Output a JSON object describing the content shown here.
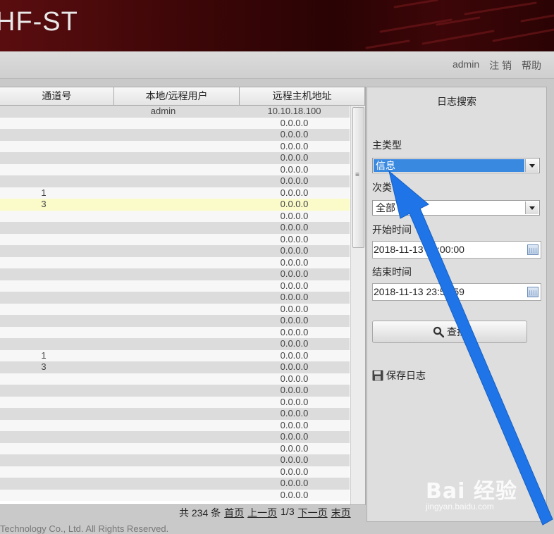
{
  "header": {
    "title": "HF-ST"
  },
  "toolbar": {
    "user": "admin",
    "logout": "注 销",
    "help": "帮助"
  },
  "table": {
    "columns": [
      "通道号",
      "本地/远程用户",
      "远程主机地址"
    ],
    "rows": [
      {
        "channel": "",
        "user": "admin",
        "host": "10.10.18.100"
      },
      {
        "channel": "",
        "user": "",
        "host": "0.0.0.0"
      },
      {
        "channel": "",
        "user": "",
        "host": "0.0.0.0"
      },
      {
        "channel": "",
        "user": "",
        "host": "0.0.0.0"
      },
      {
        "channel": "",
        "user": "",
        "host": "0.0.0.0"
      },
      {
        "channel": "",
        "user": "",
        "host": "0.0.0.0"
      },
      {
        "channel": "",
        "user": "",
        "host": "0.0.0.0"
      },
      {
        "channel": "1",
        "user": "",
        "host": "0.0.0.0"
      },
      {
        "channel": "3",
        "user": "",
        "host": "0.0.0.0",
        "highlight": true
      },
      {
        "channel": "",
        "user": "",
        "host": "0.0.0.0"
      },
      {
        "channel": "",
        "user": "",
        "host": "0.0.0.0"
      },
      {
        "channel": "",
        "user": "",
        "host": "0.0.0.0"
      },
      {
        "channel": "",
        "user": "",
        "host": "0.0.0.0"
      },
      {
        "channel": "",
        "user": "",
        "host": "0.0.0.0"
      },
      {
        "channel": "",
        "user": "",
        "host": "0.0.0.0"
      },
      {
        "channel": "",
        "user": "",
        "host": "0.0.0.0"
      },
      {
        "channel": "",
        "user": "",
        "host": "0.0.0.0"
      },
      {
        "channel": "",
        "user": "",
        "host": "0.0.0.0"
      },
      {
        "channel": "",
        "user": "",
        "host": "0.0.0.0"
      },
      {
        "channel": "",
        "user": "",
        "host": "0.0.0.0"
      },
      {
        "channel": "",
        "user": "",
        "host": "0.0.0.0"
      },
      {
        "channel": "1",
        "user": "",
        "host": "0.0.0.0"
      },
      {
        "channel": "3",
        "user": "",
        "host": "0.0.0.0"
      },
      {
        "channel": "",
        "user": "",
        "host": "0.0.0.0"
      },
      {
        "channel": "",
        "user": "",
        "host": "0.0.0.0"
      },
      {
        "channel": "",
        "user": "",
        "host": "0.0.0.0"
      },
      {
        "channel": "",
        "user": "",
        "host": "0.0.0.0"
      },
      {
        "channel": "",
        "user": "",
        "host": "0.0.0.0"
      },
      {
        "channel": "",
        "user": "",
        "host": "0.0.0.0"
      },
      {
        "channel": "",
        "user": "",
        "host": "0.0.0.0"
      },
      {
        "channel": "",
        "user": "",
        "host": "0.0.0.0"
      },
      {
        "channel": "",
        "user": "",
        "host": "0.0.0.0"
      },
      {
        "channel": "",
        "user": "",
        "host": "0.0.0.0"
      },
      {
        "channel": "",
        "user": "",
        "host": "0.0.0.0"
      }
    ]
  },
  "pager": {
    "total": "共 234 条",
    "first": "首页",
    "prev": "上一页",
    "page": "1/3",
    "next": "下一页",
    "last": "末页"
  },
  "footer": {
    "copyright": "Technology Co., Ltd. All Rights Reserved."
  },
  "search": {
    "title": "日志搜索",
    "main_type_label": "主类型",
    "main_type_value": "信息",
    "sub_type_label": "次类",
    "sub_type_value": "全部",
    "start_label": "开始时间",
    "start_value": "2018-11-13 00:00:00",
    "end_label": "结束时间",
    "end_value": "2018-11-13 23:59:59",
    "search_button": "查找",
    "save_log": "保存日志"
  },
  "watermark": {
    "brand": "Bai 经验",
    "url": "jingyan.baidu.com"
  },
  "colors": {
    "banner": "#3c0607",
    "selection": "#3a89e0",
    "highlight_row": "#fbfbc9",
    "arrow": "#1f74e8"
  }
}
